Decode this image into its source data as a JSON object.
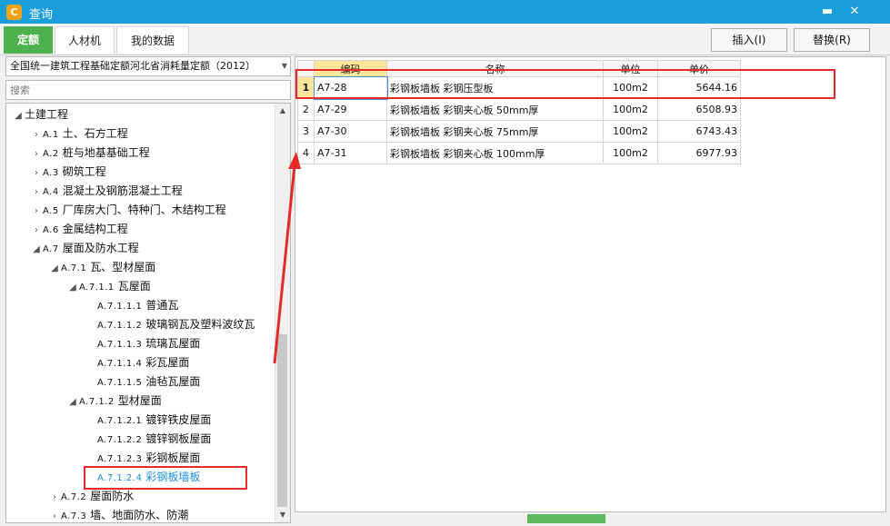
{
  "window": {
    "title": "查询",
    "logo_glyph": "C",
    "min_glyph": "▬",
    "close_glyph": "✕"
  },
  "tabs": [
    {
      "label": "定额"
    },
    {
      "label": "人材机"
    },
    {
      "label": "我的数据"
    }
  ],
  "toolbar": {
    "insert_label": "插入(I)",
    "replace_label": "替换(R)"
  },
  "quota_select": {
    "value": "全国统一建筑工程基础定额河北省消耗量定额（2012）"
  },
  "search": {
    "placeholder": "搜索"
  },
  "tree": [
    {
      "exp": "◢",
      "code": "",
      "label": "土建工程"
    },
    {
      "exp": "›",
      "code": "A.1",
      "label": "土、石方工程"
    },
    {
      "exp": "›",
      "code": "A.2",
      "label": "桩与地基基础工程"
    },
    {
      "exp": "›",
      "code": "A.3",
      "label": "砌筑工程"
    },
    {
      "exp": "›",
      "code": "A.4",
      "label": "混凝土及钢筋混凝土工程"
    },
    {
      "exp": "›",
      "code": "A.5",
      "label": "厂库房大门、特种门、木结构工程"
    },
    {
      "exp": "›",
      "code": "A.6",
      "label": "金属结构工程"
    },
    {
      "exp": "◢",
      "code": "A.7",
      "label": "屋面及防水工程"
    },
    {
      "exp": "◢",
      "code": "A.7.1",
      "label": "瓦、型材屋面"
    },
    {
      "exp": "◢",
      "code": "A.7.1.1",
      "label": "瓦屋面"
    },
    {
      "exp": "",
      "code": "A.7.1.1.1",
      "label": "普通瓦"
    },
    {
      "exp": "",
      "code": "A.7.1.1.2",
      "label": "玻璃钢瓦及塑料波纹瓦"
    },
    {
      "exp": "",
      "code": "A.7.1.1.3",
      "label": "琉璃瓦屋面"
    },
    {
      "exp": "",
      "code": "A.7.1.1.4",
      "label": "彩瓦屋面"
    },
    {
      "exp": "",
      "code": "A.7.1.1.5",
      "label": "油毡瓦屋面"
    },
    {
      "exp": "◢",
      "code": "A.7.1.2",
      "label": "型材屋面"
    },
    {
      "exp": "",
      "code": "A.7.1.2.1",
      "label": "镀锌铁皮屋面"
    },
    {
      "exp": "",
      "code": "A.7.1.2.2",
      "label": "镀锌钢板屋面"
    },
    {
      "exp": "",
      "code": "A.7.1.2.3",
      "label": "彩钢板屋面"
    },
    {
      "exp": "",
      "code": "A.7.1.2.4",
      "label": "彩钢板墙板"
    },
    {
      "exp": "›",
      "code": "A.7.2",
      "label": "屋面防水"
    },
    {
      "exp": "›",
      "code": "A.7.3",
      "label": "墙、地面防水、防潮"
    }
  ],
  "grid": {
    "headers": {
      "code": "编码",
      "name": "名称",
      "unit": "单位",
      "price": "单价"
    },
    "rows": [
      {
        "n": "1",
        "code": "A7-28",
        "name": "彩钢板墙板 彩钢压型板",
        "unit": "100m2",
        "price": "5644.16"
      },
      {
        "n": "2",
        "code": "A7-29",
        "name": "彩钢板墙板 彩钢夹心板 50mm厚",
        "unit": "100m2",
        "price": "6508.93"
      },
      {
        "n": "3",
        "code": "A7-30",
        "name": "彩钢板墙板 彩钢夹心板 75mm厚",
        "unit": "100m2",
        "price": "6743.43"
      },
      {
        "n": "4",
        "code": "A7-31",
        "name": "彩钢板墙板 彩钢夹心板 100mm厚",
        "unit": "100m2",
        "price": "6977.93"
      }
    ]
  },
  "colors": {
    "titlebar": "#1a9dd9",
    "active_tab": "#4eb14e",
    "selection": "#fde69a",
    "annotation": "#e52a2a",
    "selected_tree_text": "#1a8fd8"
  }
}
